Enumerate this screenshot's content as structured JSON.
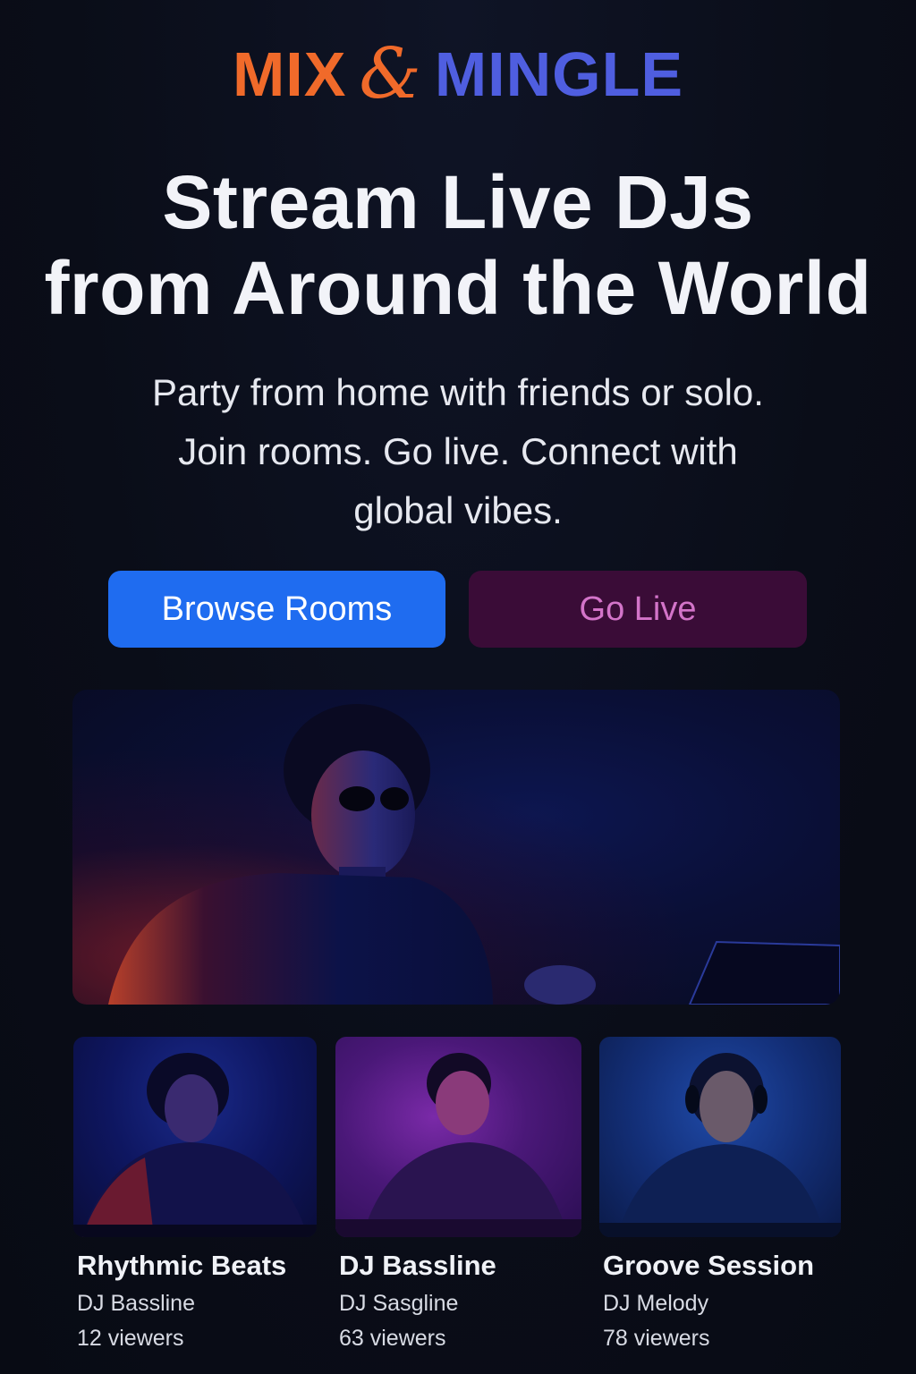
{
  "brand": {
    "part1": "MIX",
    "connector": "&",
    "part2": "MINGLE",
    "colors": {
      "mix": "#f06a2a",
      "mingle": "#4f5ee0"
    }
  },
  "hero": {
    "headline_line1": "Stream Live DJs",
    "headline_line2": "from Around the World",
    "subtitle_line1": "Party from home with friends or solo.",
    "subtitle_line2": "Join rooms. Go live. Connect with",
    "subtitle_line3": "global vibes.",
    "featured_image": "dj-with-headphones-photo"
  },
  "actions": {
    "browse_label": "Browse Rooms",
    "live_label": "Go Live",
    "colors": {
      "browse": "#1f6cf0",
      "live_bg": "#3a0c37",
      "live_text": "#d374c9"
    }
  },
  "rooms": [
    {
      "title": "Rhythmic Beats",
      "dj": "DJ Bassline",
      "viewers": "12 viewers",
      "image": "dj-photo-blue"
    },
    {
      "title": "DJ Bassline",
      "dj": "DJ Sasgline",
      "viewers": "63 viewers",
      "image": "dj-photo-purple"
    },
    {
      "title": "Groove Session",
      "dj": "DJ Melody",
      "viewers": "78 viewers",
      "image": "dj-photo-headphones"
    }
  ]
}
